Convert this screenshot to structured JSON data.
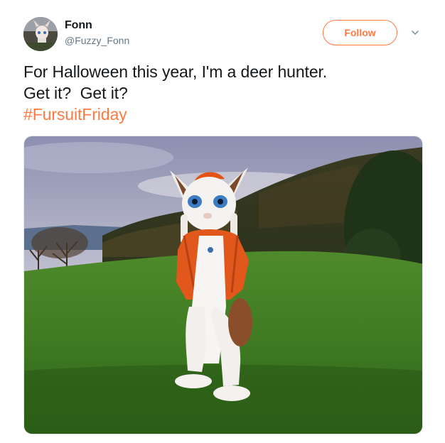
{
  "author": {
    "display_name": "Fonn",
    "handle": "@Fuzzy_Fonn",
    "avatar_icon": "fursuit-avatar"
  },
  "actions": {
    "follow_label": "Follow",
    "more_icon": "chevron-down-icon"
  },
  "tweet": {
    "line1": "For Halloween this year, I'm a deer hunter.",
    "line2": "Get it?  Get it?",
    "hashtag": "#FursuitFriday"
  },
  "media": {
    "subject": "fursuit-photo"
  },
  "colors": {
    "accent": "#ff7940",
    "text": "#14171a",
    "secondary_text": "#657786"
  }
}
